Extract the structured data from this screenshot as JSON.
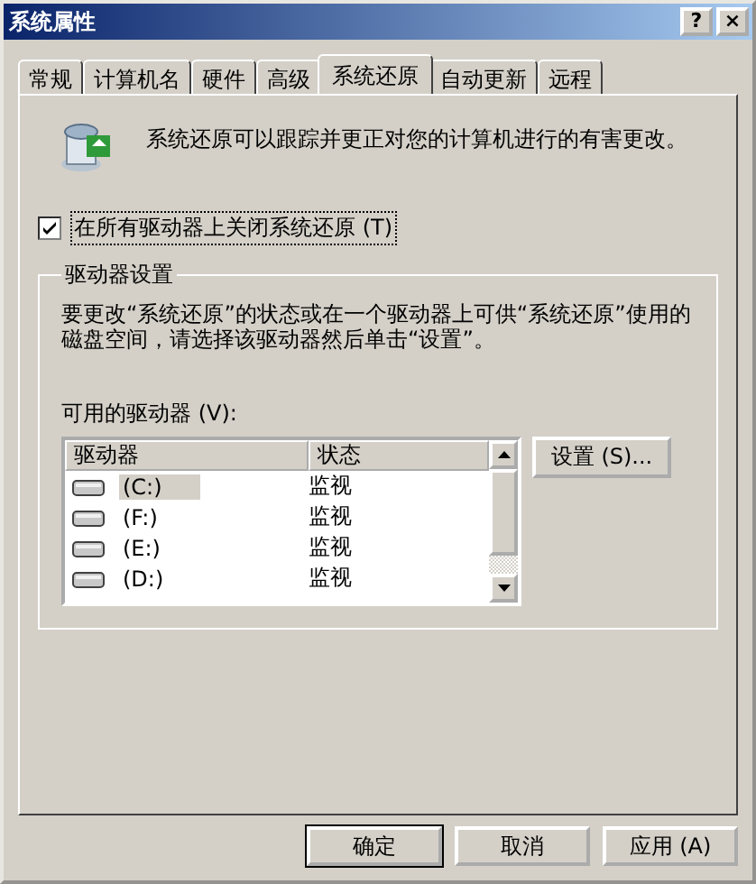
{
  "window": {
    "title": "系统属性",
    "title_buttons": [
      "?",
      "×"
    ]
  },
  "tabs": [
    {
      "label": "常规",
      "selected": false
    },
    {
      "label": "计算机名",
      "selected": false
    },
    {
      "label": "硬件",
      "selected": false
    },
    {
      "label": "高级",
      "selected": false
    },
    {
      "label": "系统还原",
      "selected": true
    },
    {
      "label": "自动更新",
      "selected": false
    },
    {
      "label": "远程",
      "selected": false
    }
  ],
  "intro": "系统还原可以跟踪并更正对您的计算机进行的有害更改。",
  "turn_off_checkbox": {
    "label": "在所有驱动器上关闭系统还原 (T)",
    "checked": true
  },
  "drive_settings": {
    "title": "驱动器设置",
    "description": "要更改“系统还原”的状态或在一个驱动器上可供“系统还原”使用的磁盘空间，请选择该驱动器然后单击“设置”。",
    "list_label": "可用的驱动器 (V):",
    "columns": [
      "驱动器",
      "状态"
    ],
    "rows": [
      {
        "drive": "(C:)",
        "status": "监视",
        "selected": true
      },
      {
        "drive": "(F:)",
        "status": "监视",
        "selected": false
      },
      {
        "drive": "(E:)",
        "status": "监视",
        "selected": false
      },
      {
        "drive": "(D:)",
        "status": "监视",
        "selected": false
      }
    ],
    "settings_button": "设置 (S)..."
  },
  "buttons": [
    {
      "label": "确定",
      "default": true
    },
    {
      "label": "取消",
      "default": false
    },
    {
      "label": "应用 (A)",
      "default": false
    }
  ]
}
